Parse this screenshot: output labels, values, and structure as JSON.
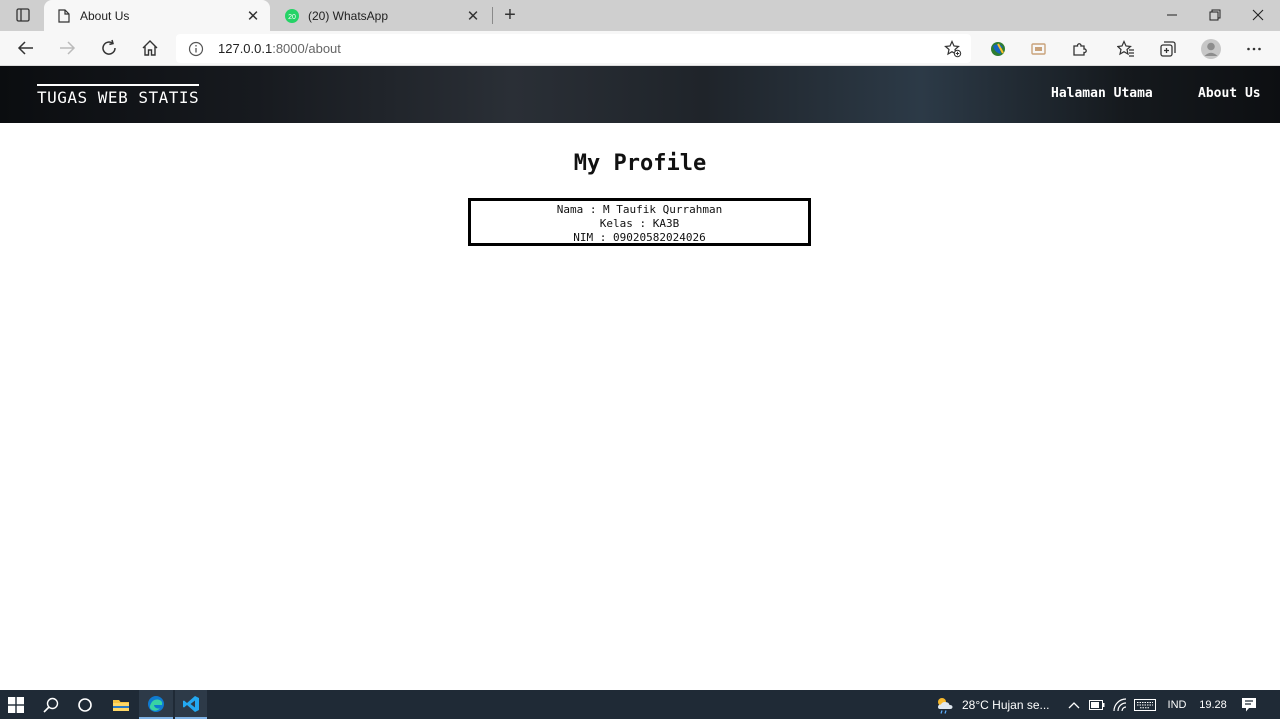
{
  "browser": {
    "tabs": [
      {
        "title": "About Us",
        "icon": "page-icon",
        "active": true
      },
      {
        "title": "(20) WhatsApp",
        "icon": "whatsapp-icon",
        "badge": "20",
        "active": false
      }
    ],
    "url_host": "127.0.0.1",
    "url_path": ":8000/about"
  },
  "site": {
    "brand": "TUGAS WEB STATIS",
    "nav": [
      {
        "label": "Halaman Utama"
      },
      {
        "label": "About Us"
      }
    ]
  },
  "profile": {
    "title": "My Profile",
    "lines": [
      "Nama : M Taufik Qurrahman",
      "Kelas : KA3B",
      "NIM : 09020582024026"
    ]
  },
  "taskbar": {
    "weather": "28°C  Hujan se...",
    "language": "IND",
    "time": "19.28"
  },
  "colors": {
    "header_bg": "#1a1f25",
    "taskbar_bg": "#1f2a36",
    "whatsapp_green": "#25d366",
    "edge_blue": "#0f7bd1",
    "vscode_blue": "#23a9f2"
  }
}
